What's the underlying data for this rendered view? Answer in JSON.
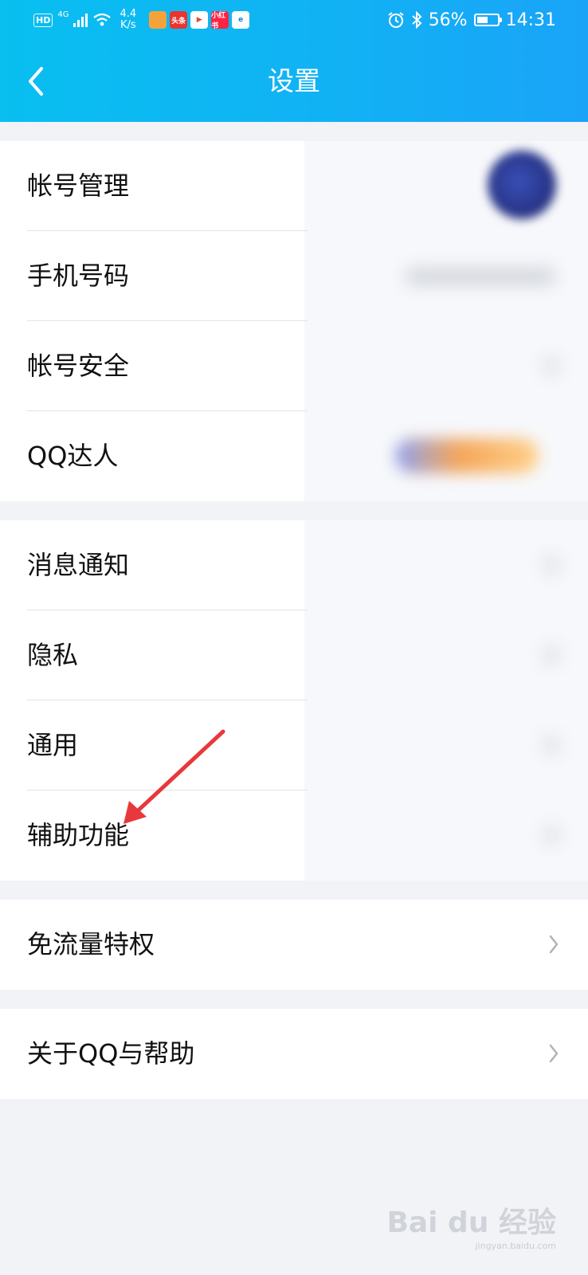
{
  "status_bar": {
    "hd": "HD",
    "network": "4G",
    "speed_value": "4.4",
    "speed_unit": "K/s",
    "app_icons": [
      "toutiao-news-icon",
      "toutiao-icon",
      "video-icon",
      "xiaohongshu-icon",
      "browser-icon"
    ],
    "app_labels": [
      "",
      "头条",
      "",
      "小红书",
      ""
    ],
    "battery": "56%",
    "battery_level": 0.56,
    "time": "14:31"
  },
  "header": {
    "title": "设置",
    "back_icon": "chevron-left-icon"
  },
  "groups": [
    {
      "items": [
        {
          "label": "帐号管理"
        },
        {
          "label": "手机号码"
        },
        {
          "label": "帐号安全"
        },
        {
          "label": "QQ达人"
        }
      ]
    },
    {
      "items": [
        {
          "label": "消息通知"
        },
        {
          "label": "隐私"
        },
        {
          "label": "通用"
        },
        {
          "label": "辅助功能"
        }
      ]
    },
    {
      "items": [
        {
          "label": "免流量特权",
          "icon": "chevron-right-icon"
        }
      ]
    },
    {
      "items": [
        {
          "label": "关于QQ与帮助",
          "icon": "chevron-right-icon"
        }
      ]
    }
  ],
  "watermark": {
    "text": "Bai du 经验",
    "sub": "jingyan.baidu.com"
  },
  "colors": {
    "header_start": "#08bff0",
    "header_end": "#1aa4f8",
    "background": "#f2f3f7",
    "annotation_arrow": "#e8383b"
  }
}
